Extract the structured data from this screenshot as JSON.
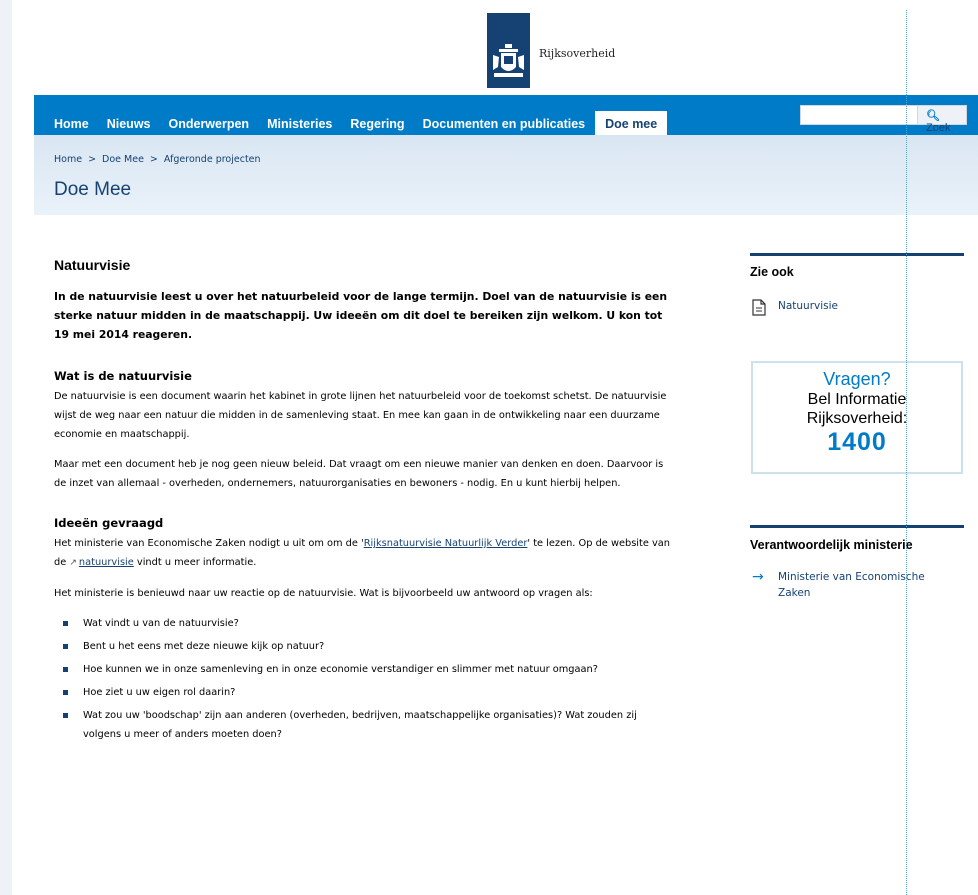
{
  "header": {
    "logo_text": "Rijksoverheid"
  },
  "nav": {
    "items": [
      "Home",
      "Nieuws",
      "Onderwerpen",
      "Ministeries",
      "Regering",
      "Documenten en publicaties"
    ],
    "active": "Doe mee",
    "search_placeholder": "",
    "search_button": "Zoek"
  },
  "breadcrumb": {
    "items": [
      "Home",
      "Doe Mee",
      "Afgeronde projecten"
    ],
    "separator": ">"
  },
  "page_title": "Doe Mee",
  "main": {
    "heading": "Natuurvisie",
    "intro": "In de natuurvisie leest u over het natuurbeleid voor de lange termijn. Doel van de natuurvisie is een sterke natuur midden in de maatschappij. Uw ideeën om dit doel te bereiken zijn welkom. U kon tot 19 mei 2014 reageren.",
    "section1": {
      "heading": "Wat is de natuurvisie",
      "p1": "De natuurvisie is een document waarin het kabinet in grote lijnen het natuurbeleid voor de toekomst schetst. De natuurvisie wijst de weg naar een natuur die midden in de samenleving staat. En mee kan gaan in de ontwikkeling naar een duurzame economie en maatschappij.",
      "p2": "Maar met een document heb je nog geen nieuw beleid. Dat vraagt om een nieuwe manier van denken en doen. Daarvoor is de inzet van allemaal - overheden, ondernemers, natuurorganisaties en bewoners - nodig. En u kunt hierbij helpen."
    },
    "section2": {
      "heading": "Ideeën gevraagd",
      "p1_before": "Het ministerie van Economische Zaken nodigt u uit om om de '",
      "p1_link": "Rijksnatuurvisie Natuurlijk Verder",
      "p1_after": "' te lezen. Op de website van de ",
      "p1_link2": "natuurvisie",
      "p1_end": " vindt u meer informatie.",
      "p2": "Het ministerie is benieuwd naar uw reactie op de natuurvisie. Wat is bijvoorbeeld uw antwoord op vragen als:",
      "list": [
        "Wat vindt u van de natuurvisie?",
        "Bent u het eens met deze nieuwe kijk op natuur?",
        "Hoe kunnen we in onze samenleving en in onze economie verstandiger en slimmer met natuur omgaan?",
        "Hoe ziet u uw eigen rol daarin?",
        "Wat zou uw 'boodschap' zijn aan anderen (overheden, bedrijven, maatschappelijke organisaties)? Wat zouden zij volgens u meer of anders moeten doen?"
      ]
    }
  },
  "sidebar": {
    "zie_ook_title": "Zie ook",
    "zie_ook_link": "Natuurvisie",
    "vragen": {
      "title": "Vragen?",
      "line1": "Bel Informatie",
      "line2": "Rijksoverheid:",
      "number": "1400"
    },
    "ministerie_title": "Verantwoordelijk ministerie",
    "ministerie_link": "Ministerie van Economische Zaken"
  },
  "colors": {
    "brand_dark": "#154273",
    "brand_blue": "#007bc7"
  }
}
